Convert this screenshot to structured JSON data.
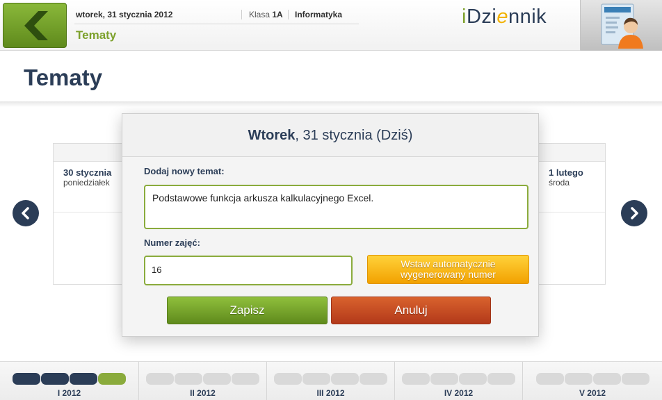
{
  "header": {
    "date": "wtorek, 31 stycznia 2012",
    "class_prefix": "Klasa",
    "class_name": "1A",
    "subject": "Informatyka",
    "section_title": "Tematy",
    "logo": {
      "part1": "i",
      "part2": "Dzi",
      "part3": "e",
      "part4": "nnik"
    }
  },
  "page": {
    "title": "Tematy"
  },
  "days": {
    "prev": {
      "date": "30 stycznia",
      "weekday": "poniedziałek"
    },
    "next": {
      "date": "1 lutego",
      "weekday": "środa"
    }
  },
  "modal": {
    "title_day": "Wtorek",
    "title_rest": ", 31 stycznia (Dziś)",
    "topic_label": "Dodaj nowy temat:",
    "topic_value": "Podstawowe funkcja arkusza kalkulacyjnego Excel.",
    "number_label": "Numer zajęć:",
    "number_value": "16",
    "auto_button": "Wstaw automatycznie wygenerowany numer",
    "save_button": "Zapisz",
    "cancel_button": "Anuluj"
  },
  "months": [
    {
      "label": "I 2012",
      "pills": [
        "done",
        "done",
        "done",
        "cur"
      ]
    },
    {
      "label": "II 2012",
      "pills": [
        "",
        "",
        "",
        ""
      ]
    },
    {
      "label": "III 2012",
      "pills": [
        "",
        "",
        "",
        ""
      ]
    },
    {
      "label": "IV 2012",
      "pills": [
        "",
        "",
        "",
        ""
      ]
    },
    {
      "label": "V 2012",
      "pills": [
        "",
        "",
        "",
        ""
      ]
    }
  ],
  "colors": {
    "navy": "#2b3d57",
    "green": "#7da12c",
    "orange": "#f2a100",
    "red": "#b3391a"
  }
}
